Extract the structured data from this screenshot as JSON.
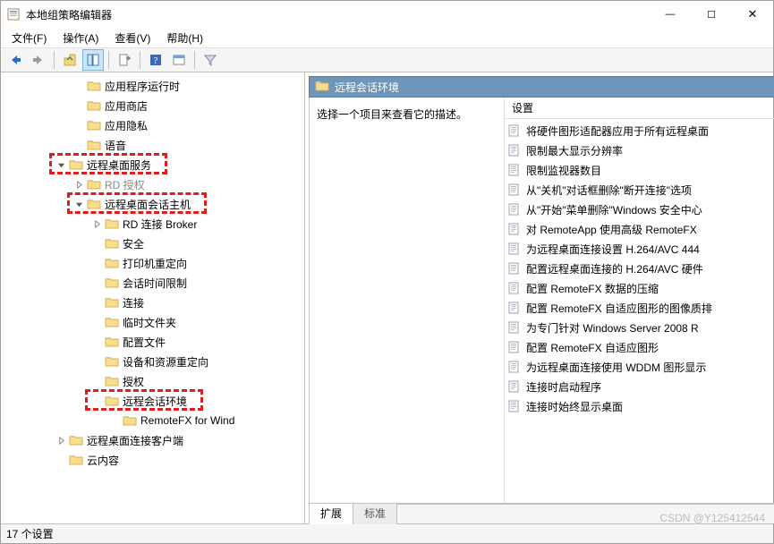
{
  "window": {
    "title": "本地组策略编辑器"
  },
  "menu": {
    "file": "文件(F)",
    "action": "操作(A)",
    "view": "查看(V)",
    "help": "帮助(H)"
  },
  "tree": {
    "items": [
      {
        "indent": 4,
        "chev": null,
        "label": "应用程序运行时"
      },
      {
        "indent": 4,
        "chev": null,
        "label": "应用商店"
      },
      {
        "indent": 4,
        "chev": null,
        "label": "应用隐私"
      },
      {
        "indent": 4,
        "chev": null,
        "label": "语音"
      },
      {
        "indent": 3,
        "chev": "open",
        "label": "远程桌面服务",
        "highlight": true
      },
      {
        "indent": 4,
        "chev": "closed",
        "label": "RD 授权",
        "fade": true
      },
      {
        "indent": 4,
        "chev": "open",
        "label": "远程桌面会话主机",
        "highlight": true
      },
      {
        "indent": 5,
        "chev": "closed",
        "label": "RD 连接 Broker"
      },
      {
        "indent": 5,
        "chev": null,
        "label": "安全"
      },
      {
        "indent": 5,
        "chev": null,
        "label": "打印机重定向"
      },
      {
        "indent": 5,
        "chev": null,
        "label": "会话时间限制"
      },
      {
        "indent": 5,
        "chev": null,
        "label": "连接"
      },
      {
        "indent": 5,
        "chev": null,
        "label": "临时文件夹"
      },
      {
        "indent": 5,
        "chev": null,
        "label": "配置文件"
      },
      {
        "indent": 5,
        "chev": null,
        "label": "设备和资源重定向"
      },
      {
        "indent": 5,
        "chev": null,
        "label": "授权"
      },
      {
        "indent": 5,
        "chev": null,
        "label": "远程会话环境",
        "highlight": true
      },
      {
        "indent": 6,
        "chev": null,
        "label": "RemoteFX for Wind"
      },
      {
        "indent": 3,
        "chev": "closed",
        "label": "远程桌面连接客户端"
      },
      {
        "indent": 3,
        "chev": null,
        "label": "云内容"
      }
    ]
  },
  "right": {
    "header": "远程会话环境",
    "desc": "选择一个项目来查看它的描述。",
    "col_header": "设置",
    "settings": [
      "将硬件图形适配器应用于所有远程桌面",
      "限制最大显示分辨率",
      "限制监视器数目",
      "从\"关机\"对话框删除\"断开连接\"选项",
      "从\"开始\"菜单删除\"Windows 安全中心",
      "对 RemoteApp 使用高级 RemoteFX",
      "为远程桌面连接设置 H.264/AVC 444",
      "配置远程桌面连接的 H.264/AVC 硬件",
      "配置 RemoteFX 数据的压缩",
      "配置 RemoteFX 自适应图形的图像质排",
      "为专门针对 Windows Server 2008 R",
      "配置 RemoteFX 自适应图形",
      "为远程桌面连接使用 WDDM 图形显示",
      "连接时启动程序",
      "连接时始终显示桌面"
    ],
    "tabs": {
      "extended": "扩展",
      "standard": "标准"
    }
  },
  "status": "17 个设置",
  "watermark": "CSDN @Y125412544"
}
